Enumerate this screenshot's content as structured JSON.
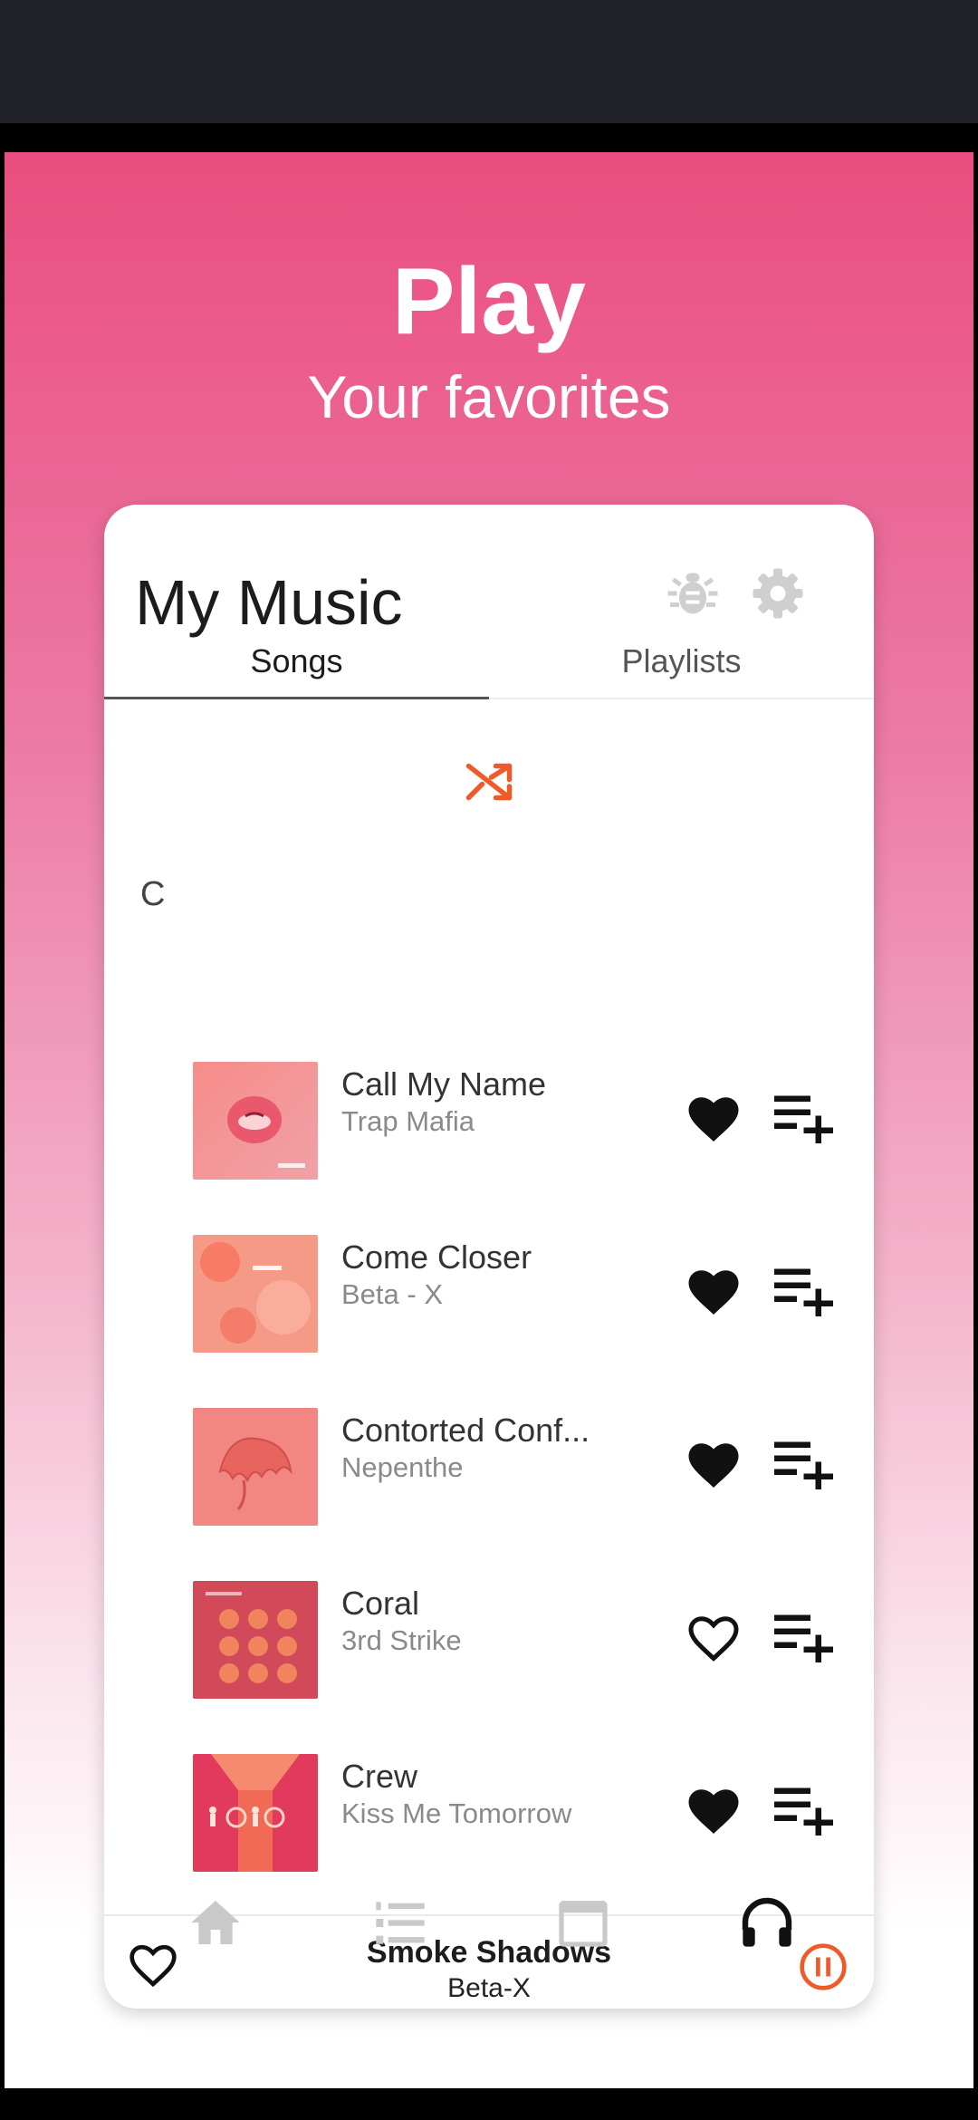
{
  "hero": {
    "title": "Play",
    "subtitle": "Your favorites"
  },
  "header": {
    "title": "My Music",
    "icons": [
      "bug-icon",
      "gear-icon"
    ]
  },
  "tabs": [
    {
      "label": "Songs",
      "active": true
    },
    {
      "label": "Playlists",
      "active": false
    }
  ],
  "section_letter": "C",
  "songs": [
    {
      "title": "Call My Name",
      "artist": "Trap Mafia",
      "favorite": true
    },
    {
      "title": "Come Closer",
      "artist": "Beta - X",
      "favorite": true
    },
    {
      "title": "Contorted Conf...",
      "artist": "Nepenthe",
      "favorite": true
    },
    {
      "title": "Coral",
      "artist": "3rd Strike",
      "favorite": false
    },
    {
      "title": "Crew",
      "artist": "Kiss Me Tomorrow",
      "favorite": true
    }
  ],
  "now_playing": {
    "title": "Smoke Shadows",
    "artist": "Beta-X",
    "favorite": false,
    "state_icon": "pause-icon"
  },
  "bottom_nav": [
    "home-icon",
    "numbered-list-icon",
    "calendar-icon",
    "headphones-icon"
  ],
  "colors": {
    "accent": "#ee5a2a",
    "gradient_top": "#ea4d80",
    "status_bar": "#202227"
  }
}
